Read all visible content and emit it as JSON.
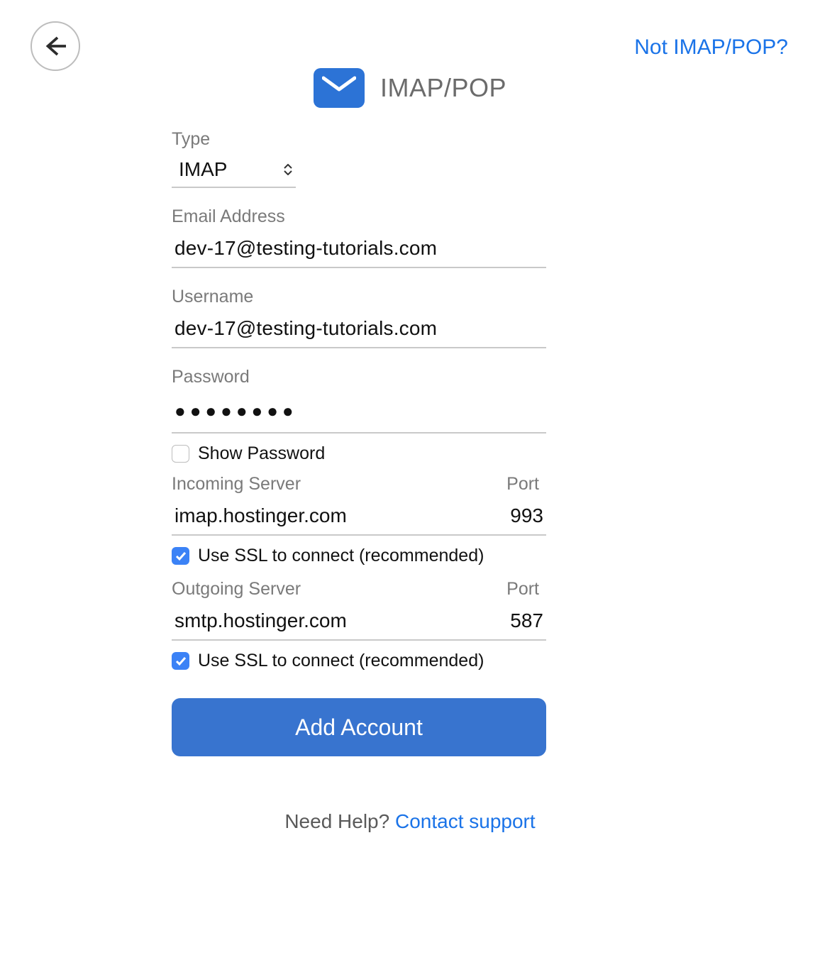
{
  "topLink": "Not IMAP/POP?",
  "headerTitle": "IMAP/POP",
  "form": {
    "typeLabel": "Type",
    "typeValue": "IMAP",
    "emailLabel": "Email Address",
    "emailValue": "dev-17@testing-tutorials.com",
    "usernameLabel": "Username",
    "usernameValue": "dev-17@testing-tutorials.com",
    "passwordLabel": "Password",
    "passwordMask": "●●●●●●●●",
    "showPasswordLabel": "Show Password",
    "showPasswordChecked": false,
    "incomingLabel": "Incoming Server",
    "incomingPortLabel": "Port",
    "incomingHost": "imap.hostinger.com",
    "incomingPort": "993",
    "incomingSslLabel": "Use SSL to connect (recommended)",
    "incomingSslChecked": true,
    "outgoingLabel": "Outgoing Server",
    "outgoingPortLabel": "Port",
    "outgoingHost": "smtp.hostinger.com",
    "outgoingPort": "587",
    "outgoingSslLabel": "Use SSL to connect (recommended)",
    "outgoingSslChecked": true,
    "addButton": "Add Account"
  },
  "help": {
    "text": "Need Help? ",
    "link": "Contact support"
  },
  "colors": {
    "accent": "#3b82f6",
    "buttonBg": "#3874cf",
    "link": "#1a73e8"
  }
}
